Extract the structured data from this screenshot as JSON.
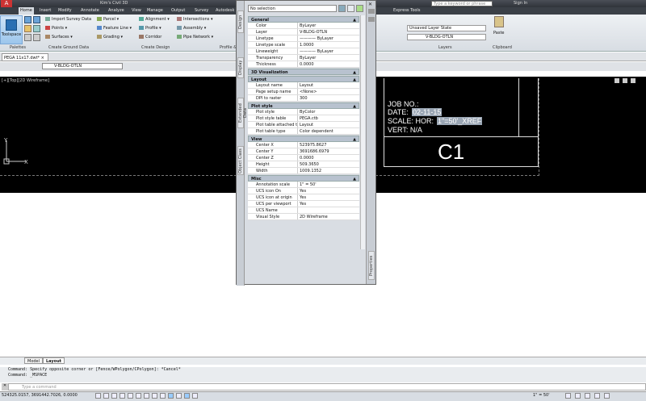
{
  "titlebar": {
    "app_title": "Kim's Civil 3D",
    "search_placeholder": "Type a keyword or phrase",
    "sign_in": "Sign In"
  },
  "menubar": {
    "items": [
      "Home",
      "Insert",
      "Modify",
      "Annotate",
      "Analyze",
      "View",
      "Manage",
      "Output",
      "Survey",
      "Autodesk"
    ],
    "right_items": [
      "Express Tools"
    ]
  },
  "ribbon": {
    "toolspace_label": "Toolspace",
    "group1": [
      "Import Survey Data",
      "Points",
      "Surfaces"
    ],
    "group2": [
      "Parcel",
      "Feature Line",
      "Grading"
    ],
    "group3": [
      "Alignment",
      "Profile",
      "Corridor"
    ],
    "group4": [
      "Intersections",
      "Assembly",
      "Pipe Network"
    ],
    "panel_labels": [
      "Palettes",
      "Create Ground Data",
      "Create Design",
      "Profile &"
    ],
    "layers": {
      "state": "Unsaved Layer State",
      "current": "V-BLDG-OTLN",
      "panel": "Layers"
    },
    "clipboard": {
      "paste": "Paste",
      "panel": "Clipboard"
    }
  },
  "document": {
    "tab": "PEGA 11x17.dwt*",
    "layer_current": "V-BLDG-OTLN",
    "viewport_label": "[+][Top][2D Wireframe]"
  },
  "titleblock": {
    "job_no": "JOB NO.:",
    "date_label": "DATE:",
    "date_value": "02-11-15",
    "scale_label": "SCALE:  HOR:",
    "scale_value": "1\"=50'_XREF",
    "vert": "VERT: N/A",
    "sheet": "C1"
  },
  "properties": {
    "selection": "No selection",
    "side_tabs": [
      "Design",
      "Display",
      "Extended Data",
      "Object Class"
    ],
    "panel_name": "Properties",
    "sections": [
      {
        "name": "General",
        "rows": [
          [
            "Color",
            "ByLayer"
          ],
          [
            "Layer",
            "V-BLDG-OTLN"
          ],
          [
            "Linetype",
            "———— ByLayer"
          ],
          [
            "Linetype scale",
            "1.0000"
          ],
          [
            "Lineweight",
            "———— ByLayer"
          ],
          [
            "Transparency",
            "ByLayer"
          ],
          [
            "Thickness",
            "0.0000"
          ]
        ]
      },
      {
        "name": "3D Visualization",
        "rows": []
      },
      {
        "name": "Layout",
        "rows": [
          [
            "Layout name",
            "Layout"
          ],
          [
            "Page setup name",
            "<None>"
          ],
          [
            "DPI to raster",
            "300"
          ]
        ]
      },
      {
        "name": "Plot style",
        "rows": [
          [
            "Plot style",
            "ByColor"
          ],
          [
            "Plot style table",
            "PEGA.ctb"
          ],
          [
            "Plot table attached to",
            "Layout"
          ],
          [
            "Plot table type",
            "Color dependent"
          ]
        ]
      },
      {
        "name": "View",
        "rows": [
          [
            "Center X",
            "523975.8627"
          ],
          [
            "Center Y",
            "3691686.6979"
          ],
          [
            "Center Z",
            "0.0000"
          ],
          [
            "Height",
            "509.3650"
          ],
          [
            "Width",
            "1009.1352"
          ]
        ]
      },
      {
        "name": "Misc",
        "rows": [
          [
            "Annotation scale",
            "1\" = 50'"
          ],
          [
            "UCS icon On",
            "Yes"
          ],
          [
            "UCS icon at origin",
            "Yes"
          ],
          [
            "UCS per viewport",
            "Yes"
          ],
          [
            "UCS Name",
            ""
          ],
          [
            "Visual Style",
            "2D Wireframe"
          ]
        ]
      }
    ]
  },
  "layout_tabs": [
    "Model",
    "Layout"
  ],
  "command": {
    "line1": "Command: Specify opposite corner or [Fence/WPolygon/CPolygon]: *Cancel*",
    "line2": "Command:  _MSPACE",
    "placeholder": "Type a command"
  },
  "status": {
    "coords": "524325.0157, 3691442.7026, 0.0000",
    "scale": "1\" = 50'"
  },
  "colors": {
    "accent": "#3b4047",
    "selection_highlight": "#9aa6b4"
  }
}
